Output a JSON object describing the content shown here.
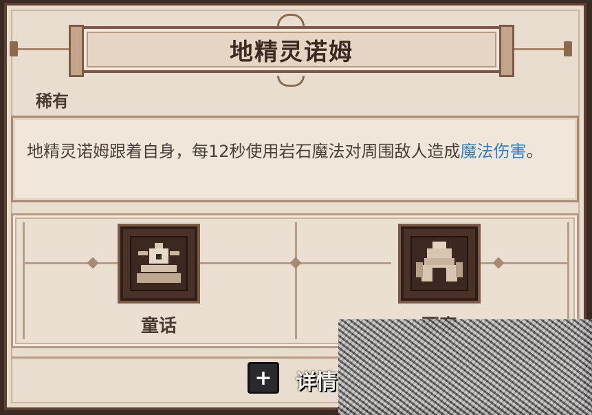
{
  "card": {
    "title": "地精灵诺姆",
    "rarity": "稀有",
    "description_before": "地精灵诺姆跟着自身，每12秒使用岩石魔法对周围敌人造成",
    "description_highlight": "魔法伤害",
    "description_after": "。",
    "highlight_color": "#2f7fc7"
  },
  "tags": [
    {
      "label": "童话",
      "icon": "crowned-beetle-icon"
    },
    {
      "label": "要塞",
      "icon": "fortress-helmet-icon"
    }
  ],
  "footer": {
    "detail_icon": "plus-icon",
    "detail_symbol": "+",
    "detail_label": "详情"
  }
}
